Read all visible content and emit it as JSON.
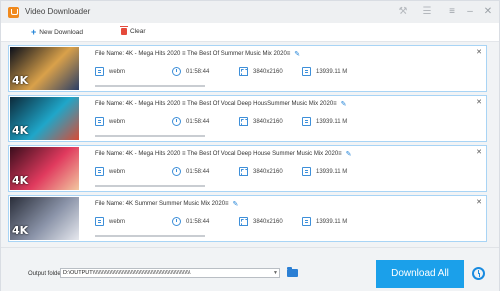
{
  "app": {
    "title": "Video Downloader"
  },
  "toolbar": {
    "new_label": "New Download",
    "clear_label": "Clear"
  },
  "items": [
    {
      "filename": "File Name: 4K - Mega Hits 2020 ≡ The Best Of  Summer Music Mix 2020≡",
      "format": "webm",
      "duration": "01:58:44",
      "resolution": "3840x2160",
      "size": "13939.11 M",
      "progress": 0,
      "thumb_badge": "4K",
      "thumb_colors": [
        "#0b0f1a",
        "#d9a14a",
        "#2b3e66"
      ]
    },
    {
      "filename": "File Name: 4K - Mega Hits 2020 ≡ The Best Of Vocal Deep HousSummer Music Mix 2020≡",
      "format": "webm",
      "duration": "01:58:44",
      "resolution": "3840x2160",
      "size": "13939.11 M",
      "progress": 0,
      "thumb_badge": "4K",
      "thumb_colors": [
        "#0c2a3a",
        "#1fa6c9",
        "#d84b35"
      ]
    },
    {
      "filename": "File Name: 4K - Mega Hits 2020 ≡ The Best Of Vocal Deep House Summer Music Mix 2020≡",
      "format": "webm",
      "duration": "01:58:44",
      "resolution": "3840x2160",
      "size": "13939.11 M",
      "progress": 0,
      "thumb_badge": "4K",
      "thumb_colors": [
        "#3a0d1c",
        "#e03a5e",
        "#f2c7a0"
      ]
    },
    {
      "filename": "File Name: 4K Summer  Summer Music Mix 2020≡",
      "format": "webm",
      "duration": "01:58:44",
      "resolution": "3840x2160",
      "size": "13939.11 M",
      "progress": 0,
      "thumb_badge": "4K",
      "thumb_colors": [
        "#2a2e3a",
        "#8a93a8",
        "#e6e8ee"
      ]
    }
  ],
  "footer": {
    "output_label": "Output folder:",
    "output_path": "D:\\OUTPUT\\\\\\\\\\\\\\\\\\\\\\\\\\\\\\\\\\\\\\\\\\\\\\\\\\\\\\\\\\\\\\\\\\\\\\\\\\\\\\\\\\\\\\\\\\\\\\\\\\\\\\\\\\\\\\\\\\\\\\\\\\\\\\\\",
    "download_all_label": "Download All"
  },
  "icons": {
    "wrench": "⚒",
    "cart": "☰",
    "menu": "≡",
    "minimize": "–",
    "close": "✕",
    "pencil": "✎"
  },
  "colors": {
    "accent": "#1ba0ea",
    "item_border": "#a8d4f5"
  }
}
